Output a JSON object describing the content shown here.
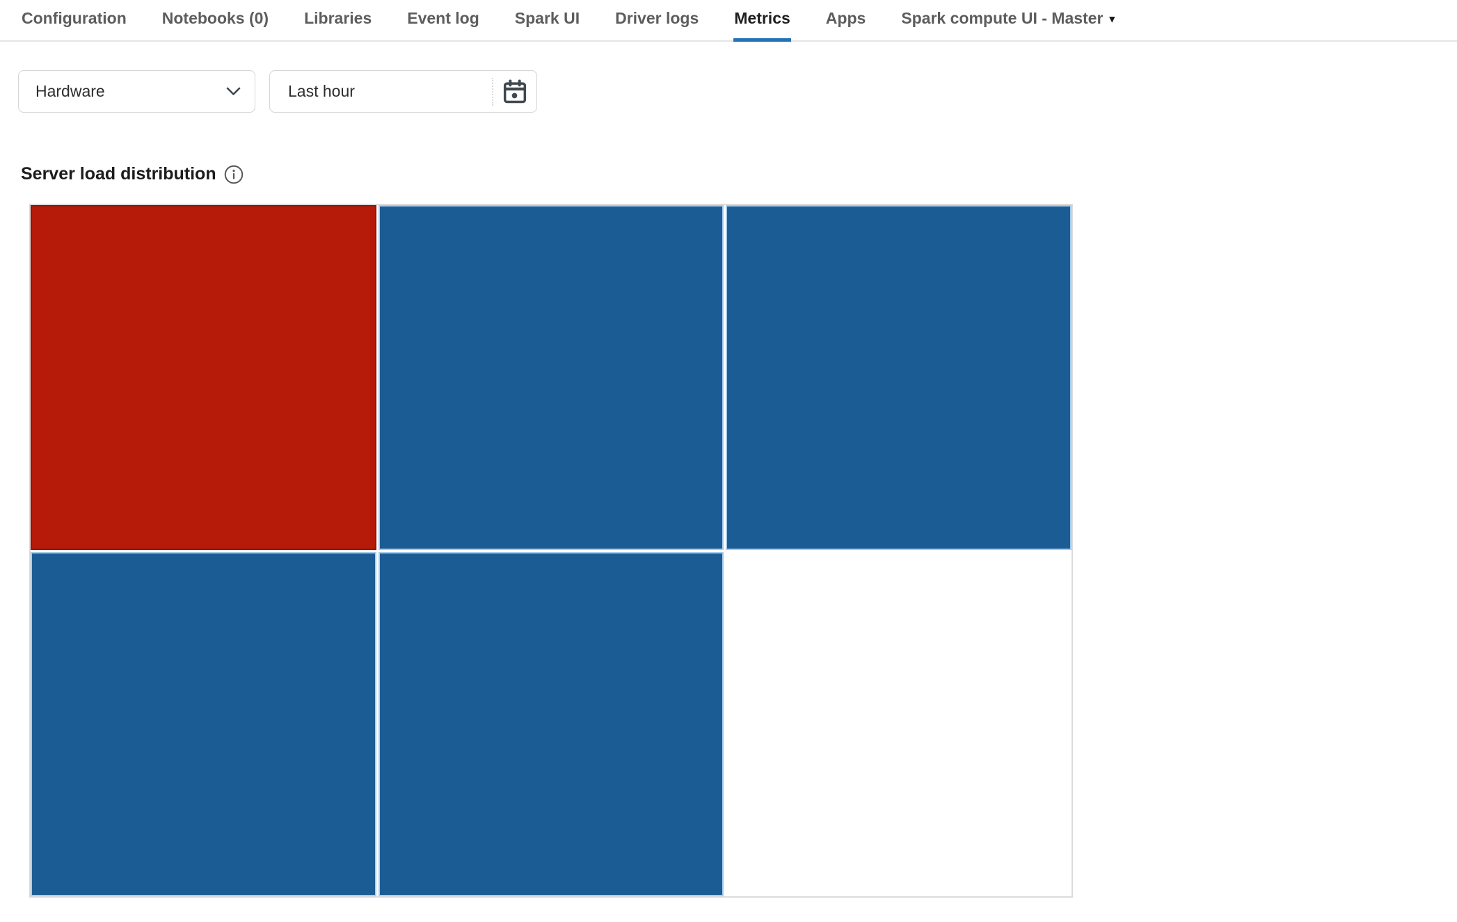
{
  "tabbar": {
    "items": [
      {
        "id": "configuration",
        "label": "Configuration",
        "active": false,
        "has_caret": false
      },
      {
        "id": "notebooks",
        "label": "Notebooks (0)",
        "active": false,
        "has_caret": false
      },
      {
        "id": "libraries",
        "label": "Libraries",
        "active": false,
        "has_caret": false
      },
      {
        "id": "event-log",
        "label": "Event log",
        "active": false,
        "has_caret": false
      },
      {
        "id": "spark-ui",
        "label": "Spark UI",
        "active": false,
        "has_caret": false
      },
      {
        "id": "driver-logs",
        "label": "Driver logs",
        "active": false,
        "has_caret": false
      },
      {
        "id": "metrics",
        "label": "Metrics",
        "active": true,
        "has_caret": false
      },
      {
        "id": "apps",
        "label": "Apps",
        "active": false,
        "has_caret": false
      },
      {
        "id": "spark-compute-ui-master",
        "label": "Spark compute UI - Master",
        "active": false,
        "has_caret": true
      }
    ],
    "caret_glyph": "▾"
  },
  "filters": {
    "metric_group": {
      "value": "Hardware",
      "icon": "chevron-down-icon"
    },
    "time_range": {
      "value": "Last hour",
      "icon": "calendar-icon"
    }
  },
  "section": {
    "title": "Server load distribution",
    "info_icon": "info-icon"
  },
  "chart_data": {
    "type": "heatmap",
    "title": "Server load distribution",
    "grid": {
      "rows": 2,
      "cols": 3
    },
    "legend_position": "none",
    "cells": [
      {
        "row": 0,
        "col": 0,
        "state": "high-load",
        "color": "#b51b08",
        "edge_color": "#951504"
      },
      {
        "row": 0,
        "col": 1,
        "state": "low-load",
        "color": "#1b5c95",
        "edge_color": "#aaceec"
      },
      {
        "row": 0,
        "col": 2,
        "state": "low-load",
        "color": "#1b5c95",
        "edge_color": "#aaceec"
      },
      {
        "row": 1,
        "col": 0,
        "state": "low-load",
        "color": "#1b5c95",
        "edge_color": "#aaceec"
      },
      {
        "row": 1,
        "col": 1,
        "state": "low-load",
        "color": "#1b5c95",
        "edge_color": "#aaceec"
      },
      {
        "row": 1,
        "col": 2,
        "state": "empty",
        "color": "",
        "edge_color": ""
      }
    ]
  },
  "colors": {
    "active_tab_underline": "#2272b4",
    "tab_inactive_text": "#5d5d5d",
    "tab_active_text": "#1f1f1f",
    "control_border": "#d4d4d4",
    "treemap_border": "#dcdcdc",
    "icon_dark": "#3f474f",
    "info_icon_gray": "#565656",
    "cell_red": "#b51b08",
    "cell_blue": "#1b5c95",
    "cell_blue_edge": "#aaceec"
  }
}
